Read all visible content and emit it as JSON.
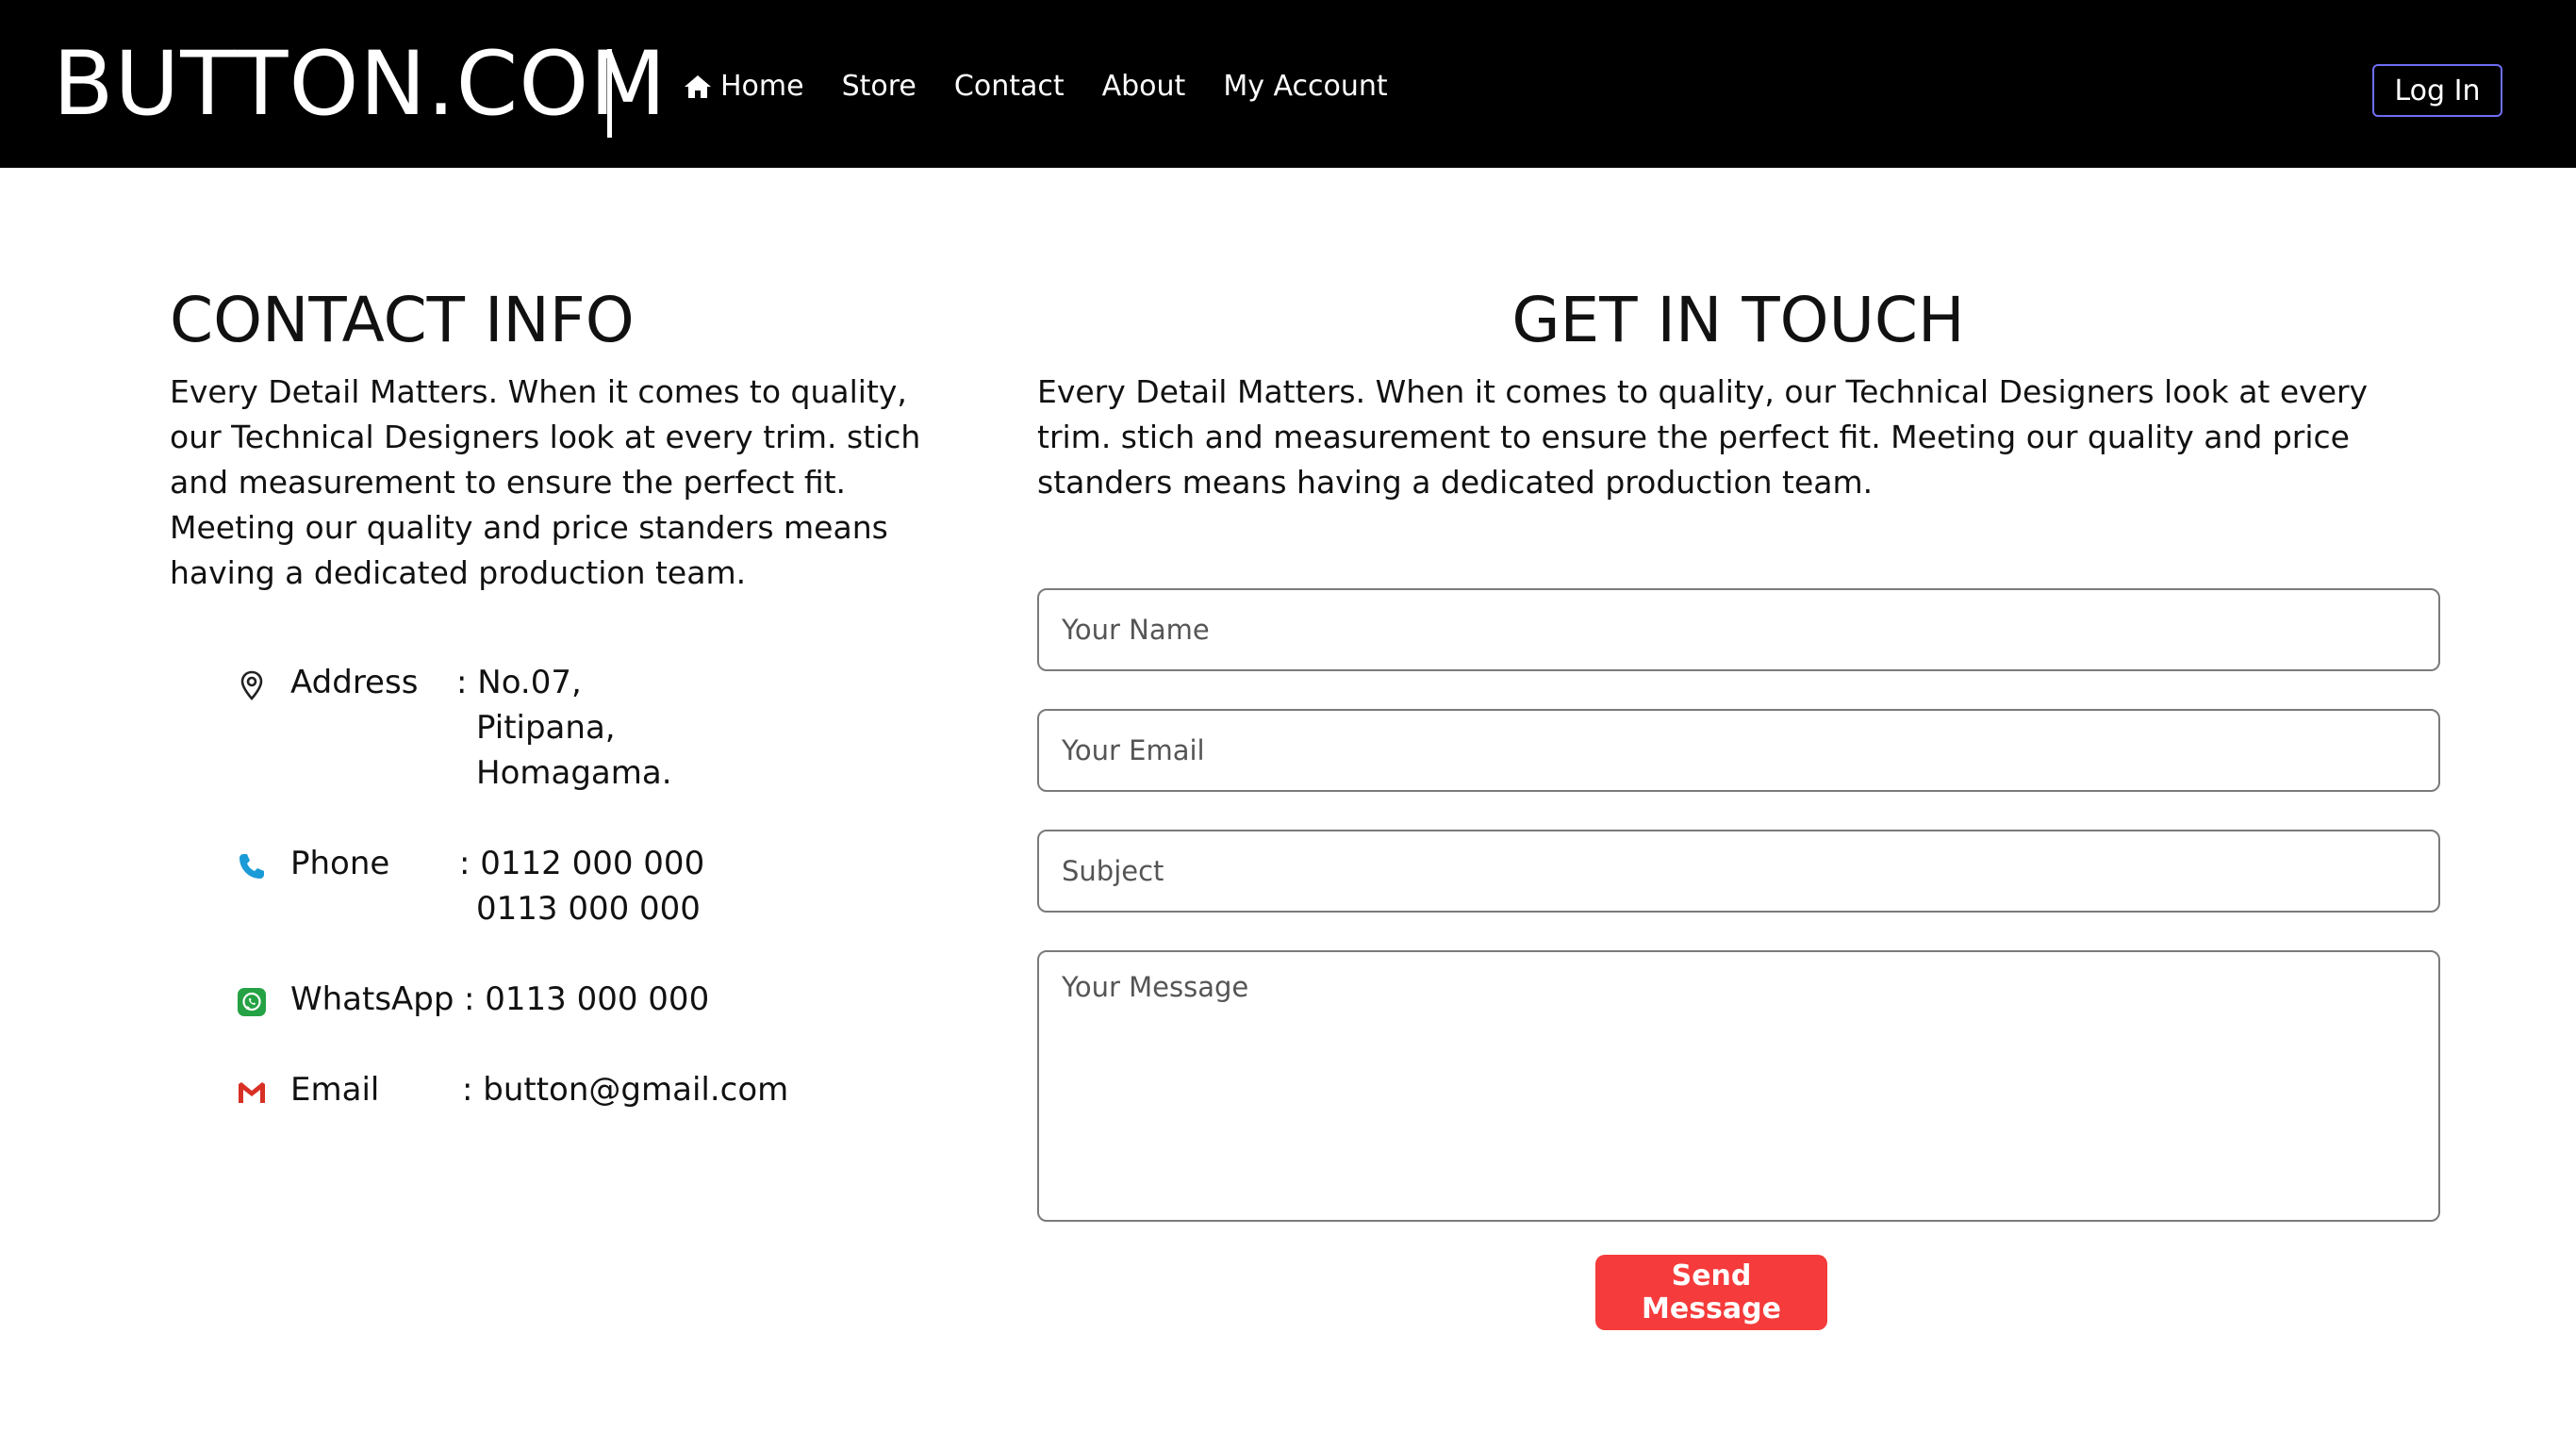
{
  "navbar": {
    "brand": "BUTTON.COM",
    "links": [
      {
        "label": "Home",
        "icon": "home-icon"
      },
      {
        "label": "Store"
      },
      {
        "label": "Contact"
      },
      {
        "label": "About"
      },
      {
        "label": "My Account"
      }
    ],
    "login_label": "Log In"
  },
  "contact_info": {
    "title": "CONTACT INFO",
    "description": "Every Detail Matters. When it comes to quality, our Technical Designers look at every trim. stich and measurement  to ensure the perfect fit. Meeting our quality and price standers means having a dedicated production team.",
    "items": [
      {
        "icon": "location-pin-icon",
        "label": "Address",
        "values": [
          ": No.07,",
          "Pitipana,",
          "Homagama."
        ]
      },
      {
        "icon": "phone-icon",
        "label": "Phone",
        "values": [
          ": 0112 000 000",
          "0113 000 000"
        ]
      },
      {
        "icon": "whatsapp-icon",
        "label": "WhatsApp",
        "values": [
          ": 0113 000 000"
        ]
      },
      {
        "icon": "gmail-icon",
        "label": "Email",
        "values": [
          ": button@gmail.com"
        ]
      }
    ]
  },
  "get_in_touch": {
    "title": "GET IN TOUCH",
    "description": "Every Detail Matters. When it comes to quality, our Technical Designers look at every trim. stich and measurement  to ensure the perfect fit. Meeting our quality and price standers means having a dedicated production team.",
    "form": {
      "name_placeholder": "Your Name",
      "email_placeholder": "Your Email",
      "subject_placeholder": "Subject",
      "message_placeholder": "Your Message",
      "submit_label": "Send Message"
    }
  },
  "colors": {
    "navbar_bg": "#000000",
    "login_border": "#6e6ef5",
    "send_button": "#f53b3b",
    "phone_icon": "#1a9bd7",
    "whatsapp_icon": "#25a244",
    "gmail_icon": "#d93025"
  }
}
